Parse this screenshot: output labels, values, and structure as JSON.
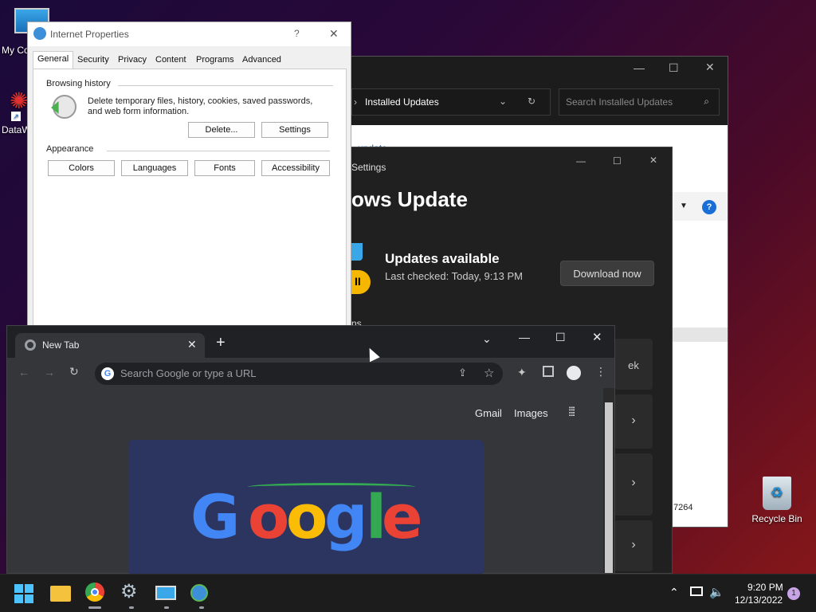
{
  "desktop": {
    "icons": [
      {
        "label": "My Co"
      },
      {
        "label": "DataW"
      },
      {
        "label": "Recycle Bin"
      }
    ]
  },
  "installed_updates": {
    "address": "Installed Updates",
    "search_placeholder": "Search Installed Updates",
    "peek_link": "update",
    "number_fragment": "7264"
  },
  "settings": {
    "window_title": "Settings",
    "heading": "ows Update",
    "status": "Updates available",
    "last_checked": "Last checked: Today, 9:13 PM",
    "download_label": "Download now",
    "section_peek": "ns",
    "card_peek": "ek"
  },
  "ie_properties": {
    "title": "Internet Properties",
    "help": "?",
    "tabs": [
      "General",
      "Security",
      "Privacy",
      "Content",
      "Programs",
      "Advanced"
    ],
    "browsing_history": {
      "heading": "Browsing history",
      "description": "Delete temporary files, history, cookies, saved passwords, and web form information.",
      "delete_label": "Delete...",
      "settings_label": "Settings"
    },
    "appearance": {
      "heading": "Appearance",
      "buttons": [
        "Colors",
        "Languages",
        "Fonts",
        "Accessibility"
      ]
    }
  },
  "chrome": {
    "tab_title": "New Tab",
    "omnibox_placeholder": "Search Google or type a URL",
    "links": [
      "Gmail",
      "Images"
    ],
    "doodle_letters": [
      "G",
      "o",
      "o",
      "g",
      "l",
      "e"
    ],
    "doodle_colors": [
      "#4285f4",
      "#ea4335",
      "#fbbc05",
      "#4285f4",
      "#34a853",
      "#ea4335"
    ]
  },
  "taskbar": {
    "apps": [
      "start",
      "file-explorer",
      "chrome",
      "settings",
      "network-connections",
      "internet-options"
    ],
    "time": "9:20 PM",
    "date": "12/13/2022",
    "notification_count": "1"
  }
}
